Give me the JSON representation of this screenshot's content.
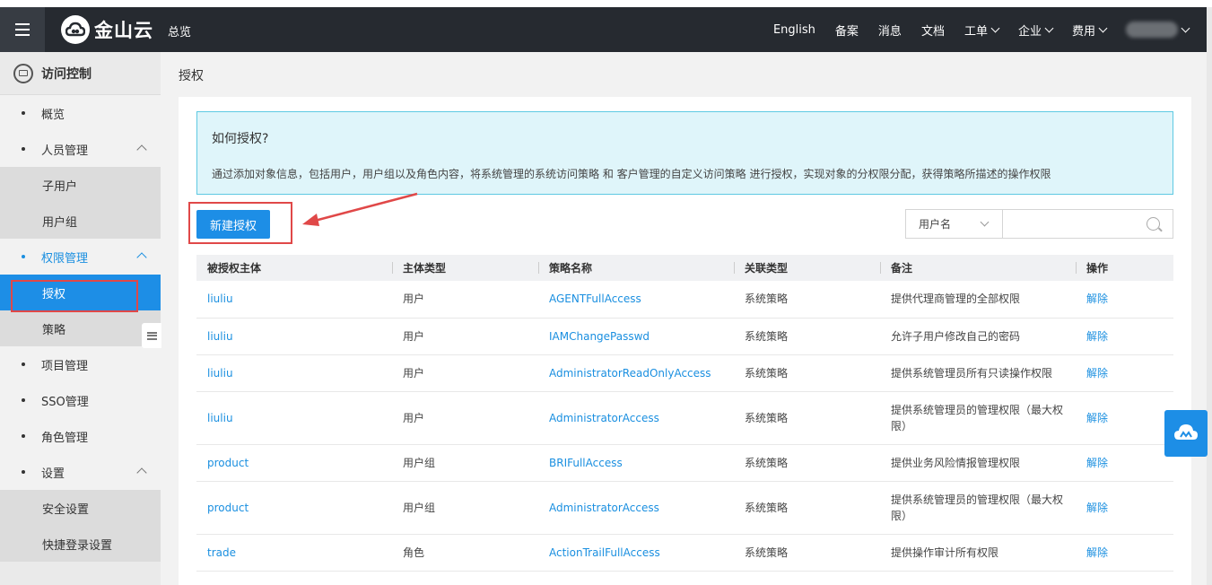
{
  "header": {
    "brand": "金山云",
    "overview": "总览",
    "nav": [
      {
        "label": "English",
        "dropdown": false
      },
      {
        "label": "备案",
        "dropdown": false
      },
      {
        "label": "消息",
        "dropdown": false
      },
      {
        "label": "文档",
        "dropdown": false
      },
      {
        "label": "工单",
        "dropdown": true
      },
      {
        "label": "企业",
        "dropdown": true
      },
      {
        "label": "费用",
        "dropdown": true
      }
    ]
  },
  "sidebar": {
    "title": "访问控制",
    "items": [
      {
        "label": "概览"
      },
      {
        "label": "人员管理",
        "sub": [
          "子用户",
          "用户组"
        ]
      },
      {
        "label": "权限管理",
        "sub": [
          "授权",
          "策略"
        ]
      },
      {
        "label": "项目管理"
      },
      {
        "label": "SSO管理"
      },
      {
        "label": "角色管理"
      },
      {
        "label": "设置",
        "sub": [
          "安全设置",
          "快捷登录设置"
        ]
      }
    ]
  },
  "main": {
    "breadcrumb": "授权",
    "info_title": "如何授权?",
    "info_text": "通过添加对象信息，包括用户，用户组以及角色内容，将系统管理的系统访问策略 和 客户管理的自定义访问策略 进行授权，实现对象的分权限分配，获得策略所描述的操作权限",
    "new_button": "新建授权",
    "filter_select": "用户名",
    "filter_input_value": "",
    "columns": [
      "被授权主体",
      "主体类型",
      "策略名称",
      "关联类型",
      "备注",
      "操作"
    ],
    "rows": [
      {
        "subject": "liuliu",
        "type": "用户",
        "policy": "AGENTFullAccess",
        "relation": "系统策略",
        "note": "提供代理商管理的全部权限",
        "op": "解除"
      },
      {
        "subject": "liuliu",
        "type": "用户",
        "policy": "IAMChangePasswd",
        "relation": "系统策略",
        "note": "允许子用户修改自己的密码",
        "op": "解除"
      },
      {
        "subject": "liuliu",
        "type": "用户",
        "policy": "AdministratorReadOnlyAccess",
        "relation": "系统策略",
        "note": "提供系统管理员所有只读操作权限",
        "op": "解除"
      },
      {
        "subject": "liuliu",
        "type": "用户",
        "policy": "AdministratorAccess",
        "relation": "系统策略",
        "note": "提供系统管理员的管理权限（最大权限）",
        "op": "解除"
      },
      {
        "subject": "product",
        "type": "用户组",
        "policy": "BRIFullAccess",
        "relation": "系统策略",
        "note": "提供业务风险情报管理权限",
        "op": "解除"
      },
      {
        "subject": "product",
        "type": "用户组",
        "policy": "AdministratorAccess",
        "relation": "系统策略",
        "note": "提供系统管理员的管理权限（最大权限）",
        "op": "解除"
      },
      {
        "subject": "trade",
        "type": "角色",
        "policy": "ActionTrailFullAccess",
        "relation": "系统策略",
        "note": "提供操作审计所有权限",
        "op": "解除"
      }
    ]
  },
  "colors": {
    "topbar": "#262a30",
    "accent": "#1d8ee6",
    "highlight": "#e04848",
    "info_bg": "#dff5fa"
  }
}
